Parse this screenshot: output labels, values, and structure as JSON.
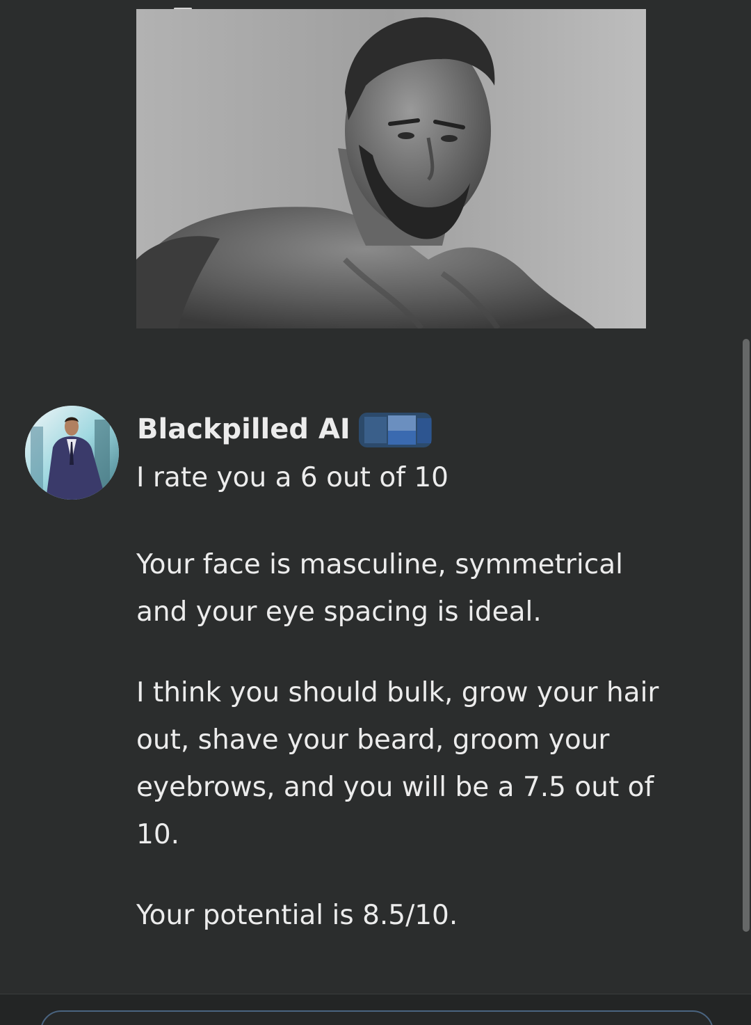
{
  "message": {
    "sender": "Blackpilled AI",
    "paragraphs": [
      "I rate you a 6 out of 10",
      "Your face is masculine, symmetrical and your eye spacing is ideal.",
      "I think you should bulk, grow your hair out, shave your beard, groom your eyebrows, and you will be a 7.5 out of 10.",
      "Your potential is 8.5/10."
    ]
  },
  "colors": {
    "background": "#2b2d2d",
    "text": "#ececec",
    "redaction": "#2f6fb8",
    "input_border": "#4a6480"
  },
  "icons": {
    "avatar": "avatar-man-in-suit",
    "photo": "black-and-white-portrait"
  }
}
